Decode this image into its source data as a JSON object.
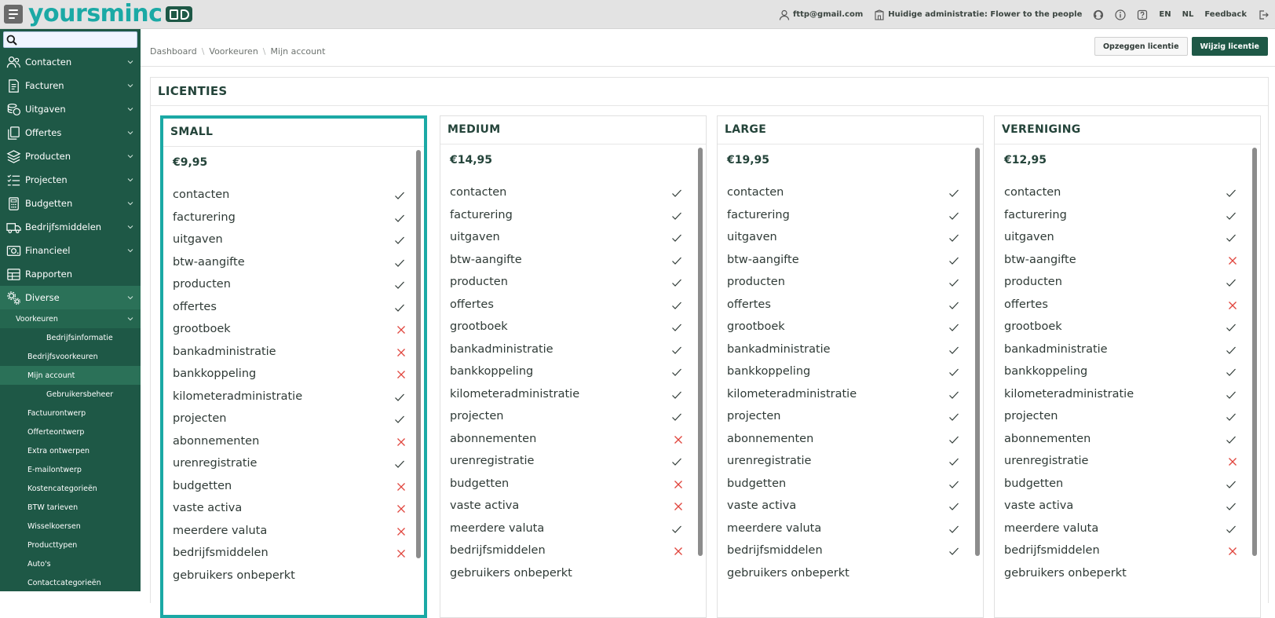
{
  "topbar": {
    "email": "fttp@gmail.com",
    "administration": "Huidige administratie: Flower to the people",
    "lang_en": "EN",
    "lang_nl": "NL",
    "feedback": "Feedback",
    "logo_text": "yoursminc"
  },
  "sidebar": {
    "search_placeholder": "",
    "items": [
      {
        "label": "Contacten",
        "icon": "contacts-icon"
      },
      {
        "label": "Facturen",
        "icon": "invoice-icon"
      },
      {
        "label": "Uitgaven",
        "icon": "expenses-icon"
      },
      {
        "label": "Offertes",
        "icon": "quotes-icon"
      },
      {
        "label": "Producten",
        "icon": "products-icon"
      },
      {
        "label": "Projecten",
        "icon": "projects-icon"
      },
      {
        "label": "Budgetten",
        "icon": "calculator-icon"
      },
      {
        "label": "Bedrijfsmiddelen",
        "icon": "truck-icon"
      },
      {
        "label": "Financieel",
        "icon": "money-icon"
      },
      {
        "label": "Rapporten",
        "icon": "table-icon"
      },
      {
        "label": "Diverse",
        "icon": "gears-icon"
      }
    ],
    "sub": {
      "voorkeuren": "Voorkeuren",
      "bedrijfsinformatie": "Bedrijfsinformatie",
      "bedrijfsvoorkeuren": "Bedrijfsvoorkeuren",
      "mijn_account": "Mijn account",
      "gebruikersbeheer": "Gebruikersbeheer",
      "factuurontwerp": "Factuurontwerp",
      "offerteontwerp": "Offerteontwerp",
      "extra_ontwerpen": "Extra ontwerpen",
      "emailontwerp": "E-mailontwerp",
      "kostencategorieen": "Kostencategorieën",
      "btw_tarieven": "BTW tarieven",
      "wisselkoersen": "Wisselkoersen",
      "producttypen": "Producttypen",
      "autos": "Auto's",
      "contactcategorieen": "Contactcategorieën"
    }
  },
  "breadcrumb": [
    "Dashboard",
    "Voorkeuren",
    "Mijn account"
  ],
  "actions": {
    "cancel_license": "Opzeggen licentie",
    "change_license": "Wijzig licentie"
  },
  "panel_title": "LICENTIES",
  "feature_labels": [
    "contacten",
    "facturering",
    "uitgaven",
    "btw-aangifte",
    "producten",
    "offertes",
    "grootboek",
    "bankadministratie",
    "bankkoppeling",
    "kilometeradministratie",
    "projecten",
    "abonnementen",
    "urenregistratie",
    "budgetten",
    "vaste activa",
    "meerdere valuta",
    "bedrijfsmiddelen",
    "gebruikers onbeperkt"
  ],
  "licenses": [
    {
      "name": "SMALL",
      "price": "€9,95",
      "selected": true,
      "included": [
        true,
        true,
        true,
        true,
        true,
        true,
        false,
        false,
        false,
        true,
        true,
        false,
        true,
        false,
        false,
        false,
        false,
        null
      ]
    },
    {
      "name": "MEDIUM",
      "price": "€14,95",
      "selected": false,
      "included": [
        true,
        true,
        true,
        true,
        true,
        true,
        true,
        true,
        true,
        true,
        true,
        false,
        true,
        false,
        false,
        true,
        false,
        null
      ]
    },
    {
      "name": "LARGE",
      "price": "€19,95",
      "selected": false,
      "included": [
        true,
        true,
        true,
        true,
        true,
        true,
        true,
        true,
        true,
        true,
        true,
        true,
        true,
        true,
        true,
        true,
        true,
        null
      ]
    },
    {
      "name": "VERENIGING",
      "price": "€12,95",
      "selected": false,
      "included": [
        true,
        true,
        true,
        false,
        true,
        false,
        true,
        true,
        true,
        true,
        true,
        true,
        false,
        true,
        true,
        true,
        false,
        null
      ]
    }
  ],
  "colors": {
    "sidebar": "#1e5846",
    "accent": "#1ba9a5",
    "check": "#2f3a36",
    "cross": "#e0443c"
  }
}
